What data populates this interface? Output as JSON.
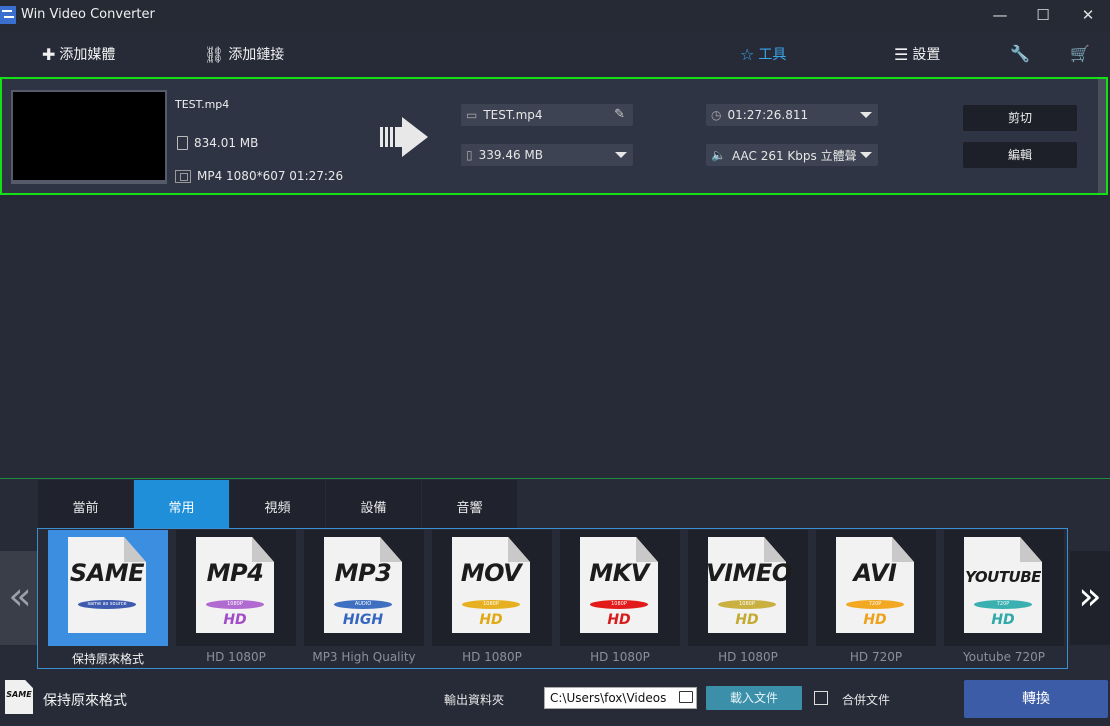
{
  "window": {
    "title": "Win Video Converter",
    "minimize": "—",
    "maximize": "☐",
    "close": "✕"
  },
  "toolbar": {
    "add_media": "添加媒體",
    "add_link": "添加鏈接",
    "tools": "工具",
    "settings": "設置"
  },
  "file": {
    "name": "TEST.mp4",
    "size": "834.01 MB",
    "info": "MP4 1080*607 01:27:26",
    "output_name": "TEST.mp4",
    "output_size": "339.46 MB",
    "duration": "01:27:26.811",
    "audio": "AAC 261 Kbps 立體聲",
    "cut_label": "剪切",
    "edit_label": "編輯"
  },
  "tabs": [
    "當前",
    "常用",
    "視頻",
    "設備",
    "音響"
  ],
  "active_tab": "常用",
  "formats": [
    {
      "name": "SAME",
      "tag": "same as source",
      "quality": "",
      "caption": "保持原來格式",
      "pill_color": "#3e5bb0",
      "quality_color": "#333"
    },
    {
      "name": "MP4",
      "tag": "1080P",
      "quality": "HD",
      "caption": "HD 1080P",
      "pill_color": "#b06ad0",
      "quality_color": "#a24cc8"
    },
    {
      "name": "MP3",
      "tag": "AUDIO",
      "quality": "HIGH",
      "caption": "MP3 High Quality",
      "pill_color": "#3e6fc0",
      "quality_color": "#3466c0"
    },
    {
      "name": "MOV",
      "tag": "1080P",
      "quality": "HD",
      "caption": "HD 1080P",
      "pill_color": "#e6b020",
      "quality_color": "#e0a812"
    },
    {
      "name": "MKV",
      "tag": "1080P",
      "quality": "HD",
      "caption": "HD 1080P",
      "pill_color": "#e21a1a",
      "quality_color": "#d81c1c"
    },
    {
      "name": "VIMEO",
      "tag": "1080P",
      "quality": "HD",
      "caption": "HD 1080P",
      "pill_color": "#c9b040",
      "quality_color": "#c4aa30"
    },
    {
      "name": "AVI",
      "tag": "720P",
      "quality": "HD",
      "caption": "HD 720P",
      "pill_color": "#f2a820",
      "quality_color": "#eea21a"
    },
    {
      "name": "YOUTUBE",
      "tag": "720P",
      "quality": "HD",
      "caption": "Youtube 720P",
      "pill_color": "#3ab0b0",
      "quality_color": "#2ea8a8"
    }
  ],
  "bottom": {
    "profile_name": "保持原來格式",
    "profile_icon": "SAME",
    "output_label": "輸出資料夾",
    "output_path": "C:\\Users\\fox\\Videos",
    "load_label": "載入文件",
    "merge_label": "合併文件",
    "convert_label": "轉換"
  }
}
